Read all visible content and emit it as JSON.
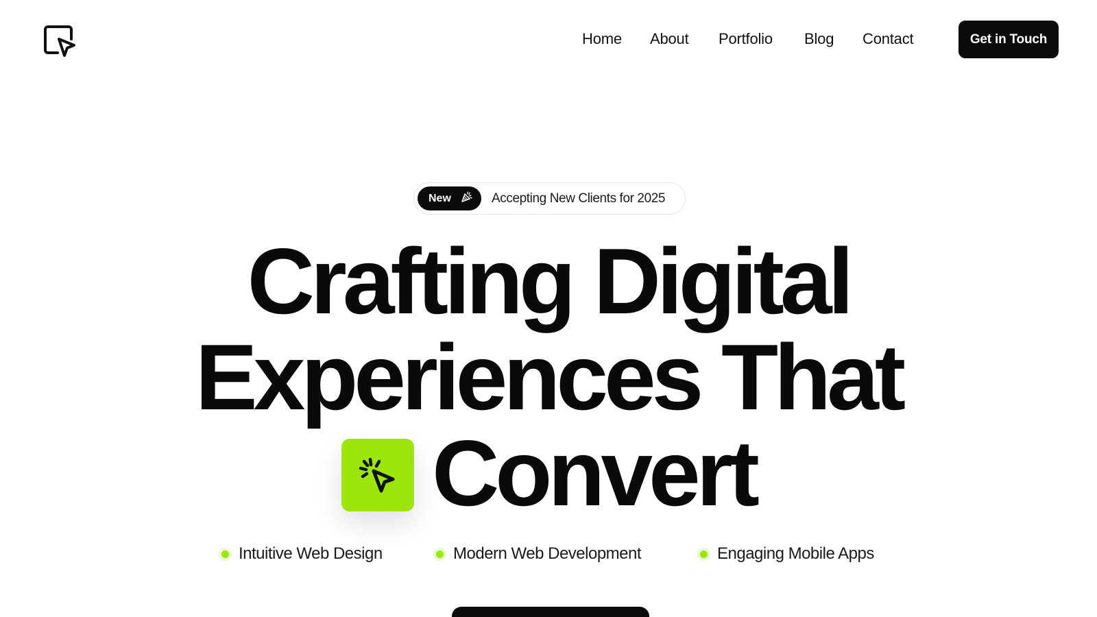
{
  "header": {
    "logo_icon": "cursor-window-icon",
    "nav": [
      {
        "label": "Home"
      },
      {
        "label": "About"
      },
      {
        "label": "Portfolio"
      },
      {
        "label": "Blog"
      },
      {
        "label": "Contact"
      }
    ],
    "cta_label": "Get in Touch"
  },
  "hero": {
    "badge": {
      "pill_label": "New",
      "pill_icon": "party-popper-icon",
      "text": "Accepting New Clients for 2025"
    },
    "headline": {
      "line1": "Crafting Digital",
      "line2": "Experiences That",
      "line3": "Convert",
      "tile_icon": "click-cursor-icon"
    },
    "features": [
      {
        "label": "Intuitive Web Design"
      },
      {
        "label": "Modern Web Development"
      },
      {
        "label": "Engaging Mobile Apps"
      }
    ]
  },
  "colors": {
    "accent": "#9be60b",
    "dark": "#0b0b0b",
    "background": "#ffffff"
  }
}
